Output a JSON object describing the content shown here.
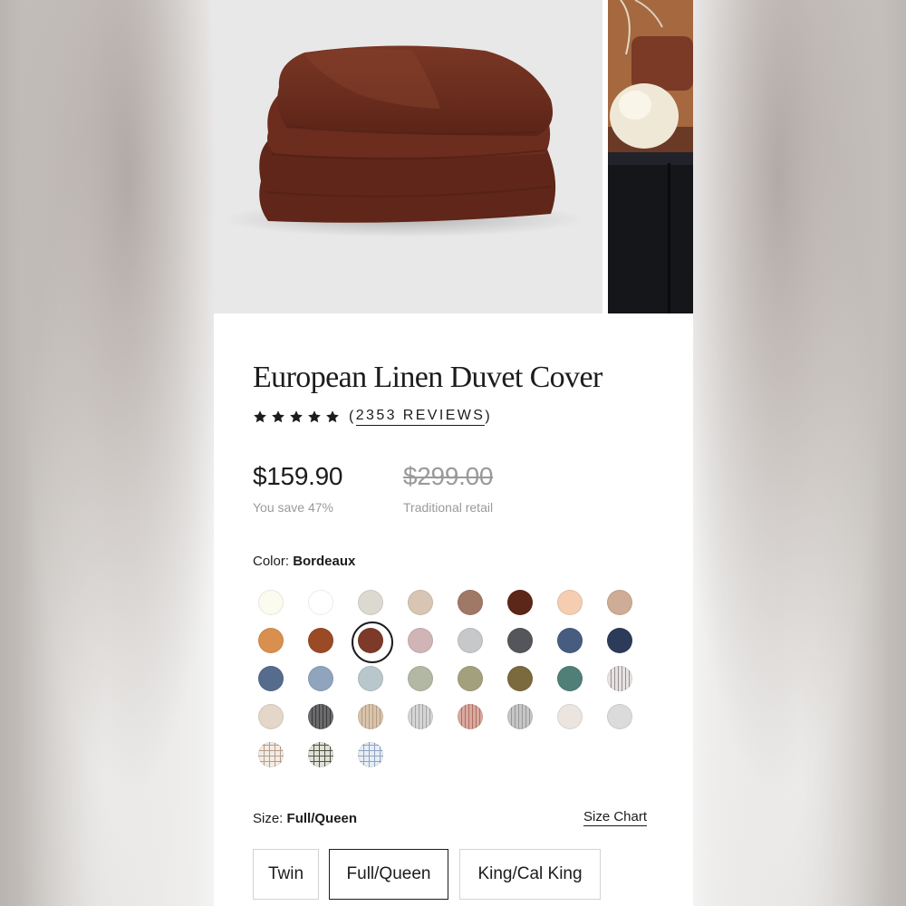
{
  "product": {
    "title": "European Linen Duvet Cover",
    "rating_stars": 5,
    "reviews_open": "(",
    "reviews_count": "2353 REVIEWS",
    "reviews_close": ")",
    "price": "$159.90",
    "savings": "You save 47%",
    "retail_price": "$299.00",
    "retail_label": "Traditional retail"
  },
  "gallery": {
    "images": [
      "folded-duvet-bordeaux",
      "bedroom-lamp-scene"
    ],
    "main_color": "#6e3021"
  },
  "color": {
    "label": "Color:",
    "selected": "Bordeaux",
    "swatches": [
      {
        "id": "ivory",
        "color": "#fbfbef",
        "selected": false
      },
      {
        "id": "white",
        "color": "#ffffff",
        "selected": false
      },
      {
        "id": "light-grey-beige",
        "color": "#dcd9d0",
        "selected": false
      },
      {
        "id": "sand",
        "color": "#d9c5b3",
        "selected": false
      },
      {
        "id": "mocha",
        "color": "#a07866",
        "selected": false
      },
      {
        "id": "chocolate",
        "color": "#5c2618",
        "selected": false
      },
      {
        "id": "peach",
        "color": "#f5cdb1",
        "selected": false
      },
      {
        "id": "blush-tan",
        "color": "#cfac95",
        "selected": false
      },
      {
        "id": "ochre",
        "color": "#d98f4e",
        "selected": false
      },
      {
        "id": "rust",
        "color": "#9a4a24",
        "selected": false
      },
      {
        "id": "bordeaux",
        "color": "#7e3a28",
        "selected": true
      },
      {
        "id": "mauve",
        "color": "#d0b4b6",
        "selected": false
      },
      {
        "id": "silver",
        "color": "#c7c8ca",
        "selected": false
      },
      {
        "id": "charcoal",
        "color": "#55565b",
        "selected": false
      },
      {
        "id": "denim",
        "color": "#465d80",
        "selected": false
      },
      {
        "id": "navy",
        "color": "#2d3b5a",
        "selected": false
      },
      {
        "id": "slate-blue",
        "color": "#566c8c",
        "selected": false
      },
      {
        "id": "periwinkle-grey",
        "color": "#90a4bd",
        "selected": false
      },
      {
        "id": "mist",
        "color": "#b8c7cb",
        "selected": false
      },
      {
        "id": "sage-grey",
        "color": "#b2b8a4",
        "selected": false
      },
      {
        "id": "sage",
        "color": "#a3a07e",
        "selected": false
      },
      {
        "id": "olive",
        "color": "#7a6a3e",
        "selected": false
      },
      {
        "id": "teal",
        "color": "#4f7f77",
        "selected": false
      },
      {
        "id": "stripe-grey",
        "color": "#e7e3e3",
        "selected": false,
        "pattern": "stripe",
        "stripe": "#9a8f91"
      },
      {
        "id": "linen-natural",
        "color": "#e4d6c8",
        "selected": false
      },
      {
        "id": "stripe-charcoal",
        "color": "#6a6a6c",
        "selected": false,
        "pattern": "stripe",
        "stripe": "#3b3b3d"
      },
      {
        "id": "stripe-oat",
        "color": "#d8c4ad",
        "selected": false,
        "pattern": "stripe",
        "stripe": "#b49c80"
      },
      {
        "id": "stripe-silver",
        "color": "#d5d5d6",
        "selected": false,
        "pattern": "stripe",
        "stripe": "#a4a4a6"
      },
      {
        "id": "stripe-terracotta",
        "color": "#d8aaa0",
        "selected": false,
        "pattern": "stripe",
        "stripe": "#b36e5f"
      },
      {
        "id": "stripe-pebble",
        "color": "#c6c6c7",
        "selected": false,
        "pattern": "stripe",
        "stripe": "#98989a"
      },
      {
        "id": "oatmeal",
        "color": "#ece5df",
        "selected": false
      },
      {
        "id": "heather",
        "color": "#dcdbdb",
        "selected": false
      },
      {
        "id": "check-tan",
        "color": "#f2ece6",
        "selected": false,
        "pattern": "check",
        "stripe": "#b89c88"
      },
      {
        "id": "check-olive",
        "color": "#dfe0d8",
        "selected": false,
        "pattern": "check",
        "stripe": "#4f5640"
      },
      {
        "id": "check-blue",
        "color": "#e8edf4",
        "selected": false,
        "pattern": "check",
        "stripe": "#8ea3c6"
      }
    ]
  },
  "size": {
    "label": "Size:",
    "selected": "Full/Queen",
    "chart_link": "Size Chart",
    "options": [
      {
        "label": "Twin",
        "selected": false
      },
      {
        "label": "Full/Queen",
        "selected": true
      },
      {
        "label": "King/Cal King",
        "selected": false
      }
    ]
  }
}
